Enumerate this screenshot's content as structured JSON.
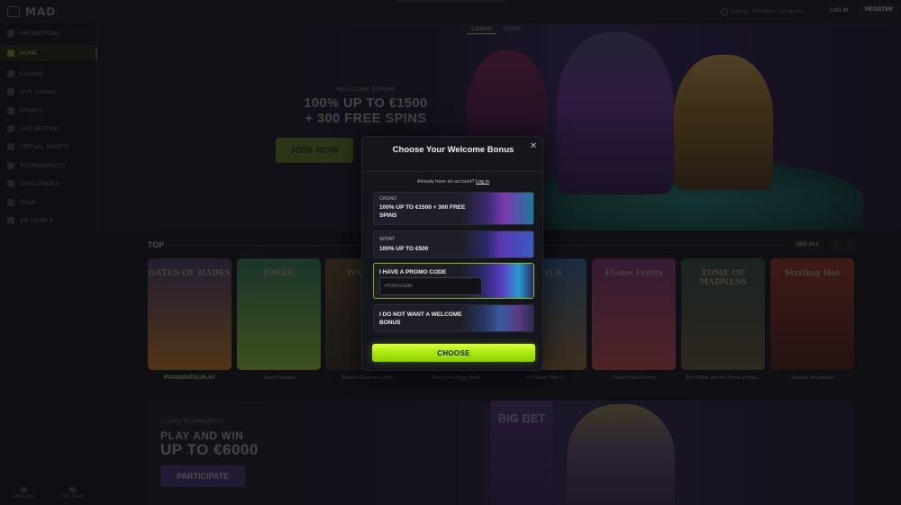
{
  "topbar": {
    "logo": "MAD",
    "search_placeholder": "Games, Providers, Categories",
    "login": "LOG IN",
    "register": "REGISTER"
  },
  "sidebar": {
    "items": [
      {
        "label": "PROMOTIONS",
        "icon": "gift-icon"
      },
      {
        "label": "HOME",
        "icon": "home-icon"
      },
      {
        "label": "CASINO",
        "icon": "cards-icon"
      },
      {
        "label": "LIVE CASINO",
        "icon": "live-icon"
      },
      {
        "label": "SPORTS",
        "icon": "ball-icon"
      },
      {
        "label": "LIVE BETTING",
        "icon": "live-bet-icon"
      },
      {
        "label": "VIRTUAL SPORTS",
        "icon": "virtual-icon"
      },
      {
        "label": "TOURNAMENTS",
        "icon": "trophy-icon"
      },
      {
        "label": "CHALLENGES",
        "icon": "target-icon"
      },
      {
        "label": "SHOP",
        "icon": "shop-icon"
      },
      {
        "label": "VIP LEVELS",
        "icon": "crown-icon"
      }
    ],
    "active_index": 1,
    "bottom": {
      "language": "ENGLISH",
      "chat": "LIVE CHAT"
    }
  },
  "hero": {
    "tabs": [
      "CASINO",
      "SPORT"
    ],
    "subtitle": "WELCOME BONUS",
    "title_line1": "100% UP TO €1500",
    "title_line2": "+ 300 FREE SPINS",
    "cta": "JOIN NOW"
  },
  "top_section": {
    "title": "TOP",
    "see_all": "SEE ALL",
    "games": [
      {
        "name": "Gates of Hades",
        "provider": "PRAGMATIC PLAY",
        "art": "GATES OF HADES",
        "colors": [
          "#3a3055",
          "#8a5a20"
        ]
      },
      {
        "name": "Joker Cashpot",
        "provider": "",
        "art": "JOKER",
        "colors": [
          "#2a5a45",
          "#6a8a30"
        ]
      },
      {
        "name": "Wanted Dead or a Wild",
        "provider": "",
        "art": "WANTED",
        "colors": [
          "#4a3a28",
          "#2a2520"
        ]
      },
      {
        "name": "Break the Piggy Bank",
        "provider": "",
        "art": "",
        "colors": [
          "#3a4a60",
          "#2a3040"
        ]
      },
      {
        "name": "It's Shark Time 2",
        "provider": "",
        "art": "BONUS",
        "colors": [
          "#2a4a70",
          "#6a5030"
        ]
      },
      {
        "name": "Flame Fruits Frenzy",
        "provider": "",
        "art": "Flame Fruits",
        "colors": [
          "#5a2a55",
          "#8a3a40"
        ]
      },
      {
        "name": "Rich Wilde and the Tome of Mad...",
        "provider": "",
        "art": "TOME OF MADNESS",
        "colors": [
          "#2a3a35",
          "#4a4030"
        ]
      },
      {
        "name": "Sizzling Hot deluxe",
        "provider": "",
        "art": "Sizzling Hot",
        "colors": [
          "#6a2a25",
          "#3a1a18"
        ]
      }
    ]
  },
  "banner": {
    "tag": "CASINO TOURNAMENTS",
    "line1": "PLAY AND WIN",
    "line2": "UP TO €6000",
    "cta": "PARTICIPATE",
    "sign": "BIG BET"
  },
  "modal": {
    "title": "Choose Your Welcome Bonus",
    "account_text": "Already have an account?",
    "login_link": "Log in",
    "options": [
      {
        "label": "CASINO",
        "text": "100% UP TO €1500 + 300 FREE SPINS"
      },
      {
        "label": "SPORT",
        "text": "100% UP TO €500"
      },
      {
        "label": "",
        "text": "I HAVE A PROMO CODE",
        "input_placeholder": "Promocode"
      },
      {
        "label": "",
        "text": "I DO NOT WANT A WELCOME BONUS"
      }
    ],
    "selected_index": 2,
    "choose": "CHOOSE",
    "accent": "#a6e60e"
  }
}
